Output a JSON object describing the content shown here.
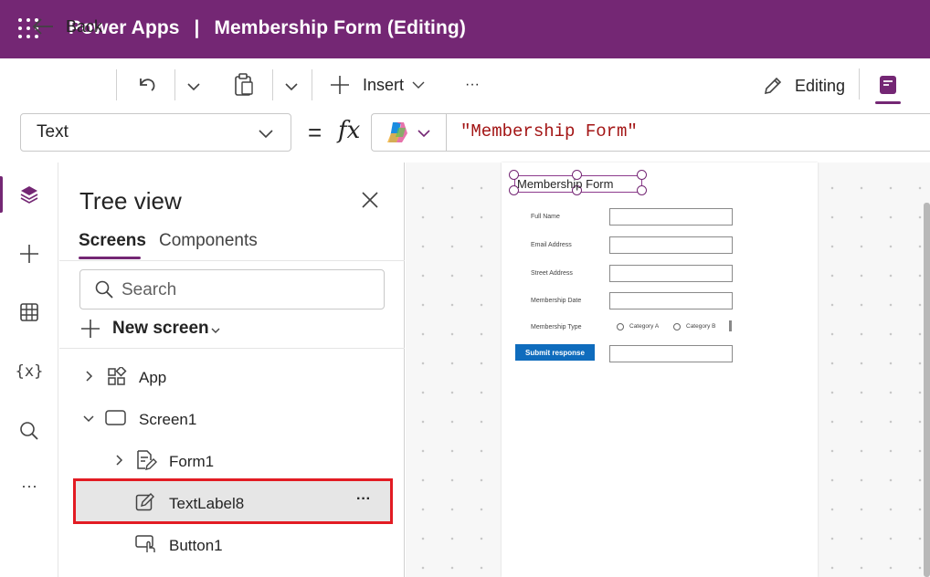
{
  "titlebar": {
    "app_name": "Power Apps",
    "separator": "|",
    "doc_title": "Membership Form (Editing)",
    "bg_color": "#742774"
  },
  "commandbar": {
    "back_label": "Back",
    "insert_label": "Insert",
    "more_label": "···",
    "editing_label": "Editing"
  },
  "formulabar": {
    "property": "Text",
    "equals": "=",
    "fx": "fx",
    "formula": "\"Membership Form\""
  },
  "rail": {
    "items": [
      "tree-view",
      "insert",
      "data",
      "variables",
      "search",
      "more"
    ]
  },
  "treeview": {
    "title": "Tree view",
    "tabs": [
      {
        "label": "Screens",
        "active": true
      },
      {
        "label": "Components",
        "active": false
      }
    ],
    "search_placeholder": "Search",
    "new_screen_label": "New screen",
    "nodes": [
      {
        "label": "App",
        "icon": "app-icon",
        "expander": "collapsed"
      },
      {
        "label": "Screen1",
        "icon": "screen-icon",
        "expander": "expanded"
      },
      {
        "label": "Form1",
        "icon": "form-icon",
        "expander": "collapsed"
      },
      {
        "label": "TextLabel8",
        "icon": "text-label-icon",
        "selected": true,
        "more": "···"
      },
      {
        "label": "Button1",
        "icon": "button-icon"
      }
    ]
  },
  "canvas": {
    "form_title": "Membership Form",
    "fields": [
      {
        "label": "Full Name"
      },
      {
        "label": "Email Address"
      },
      {
        "label": "Street Address"
      },
      {
        "label": "Membership Date"
      },
      {
        "label": "Membership Type",
        "options": [
          "Category A",
          "Category B"
        ]
      }
    ],
    "submit_label": "Submit response"
  }
}
